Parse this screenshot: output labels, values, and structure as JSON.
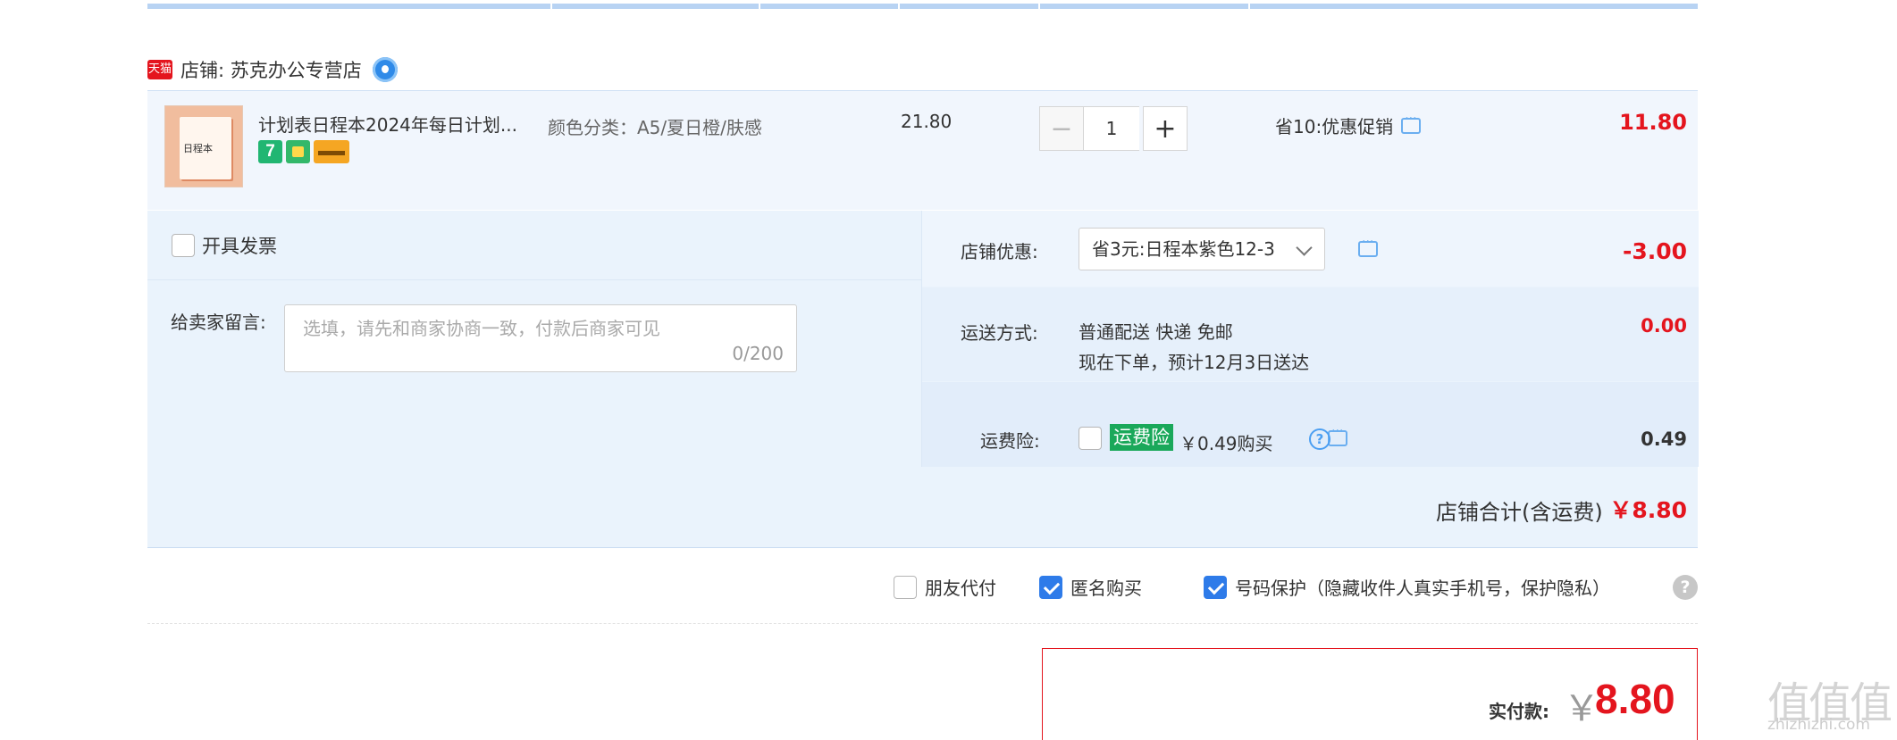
{
  "shop": {
    "tmall_badge": "天猫",
    "name": "店铺: 苏克办公专营店"
  },
  "item": {
    "thumb_text": "日程本",
    "title": "计划表日程本2024年每日计划...",
    "badge_7": "7",
    "sku": "颜色分类：A5/夏日橙/肤感",
    "price": "21.80",
    "quantity": "1",
    "minus": "−",
    "plus": "+",
    "promo": "省10:优惠促销",
    "subtotal": "11.80"
  },
  "invoice": {
    "label": "开具发票",
    "checked": false
  },
  "message": {
    "label": "给卖家留言:",
    "placeholder": "选填，请先和商家协商一致，付款后商家可见",
    "counter": "0/200"
  },
  "shop_discount": {
    "label": "店铺优惠:",
    "selected": "省3元:日程本紫色12-3",
    "amount": "-3.00"
  },
  "shipping": {
    "label": "运送方式:",
    "method": "普通配送 快递 免邮",
    "eta": "现在下单，预计12月3日送达",
    "amount": "0.00"
  },
  "shipping_insurance": {
    "label": "运费险:",
    "tag": "运费险",
    "price": "￥0.49购买",
    "help": "?",
    "amount": "0.49",
    "checked": false
  },
  "shop_total": {
    "label": "店铺合计(含运费)",
    "amount": "￥8.80"
  },
  "options": {
    "friend_pay": {
      "label": "朋友代付",
      "checked": false
    },
    "anonymous": {
      "label": "匿名购买",
      "checked": true
    },
    "number_protect": {
      "label": "号码保护（隐藏收件人真实手机号，保护隐私）",
      "checked": true
    },
    "help": "?"
  },
  "payment": {
    "label": "实付款:",
    "currency": "￥",
    "amount": "8.80"
  },
  "watermark": {
    "logo": "值值值",
    "url": "zhizhizhi.com"
  },
  "colors": {
    "price_red": "#e4151e",
    "panel_blue": "#eaf3fc",
    "check_blue": "#2e7be9",
    "insurance_green": "#1aa85a"
  }
}
